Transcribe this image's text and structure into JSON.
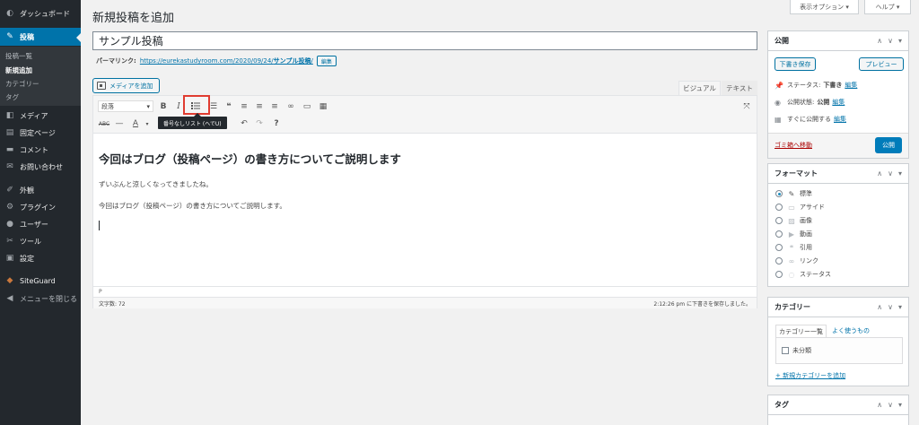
{
  "sidebar": {
    "items": [
      {
        "label": "ダッシュボード",
        "icon": "dashboard-icon",
        "glyph": "◐"
      },
      {
        "label": "投稿",
        "icon": "pin-icon",
        "glyph": "✎",
        "current": true
      },
      {
        "label": "メディア",
        "icon": "media-icon",
        "glyph": "◧"
      },
      {
        "label": "固定ページ",
        "icon": "page-icon",
        "glyph": "▤"
      },
      {
        "label": "コメント",
        "icon": "comment-icon",
        "glyph": "▬"
      },
      {
        "label": "お問い合わせ",
        "icon": "mail-icon",
        "glyph": "✉"
      },
      {
        "label": "外観",
        "icon": "brush-icon",
        "glyph": "✐"
      },
      {
        "label": "プラグイン",
        "icon": "plugin-icon",
        "glyph": "⚙"
      },
      {
        "label": "ユーザー",
        "icon": "user-icon",
        "glyph": "●"
      },
      {
        "label": "ツール",
        "icon": "wrench-icon",
        "glyph": "✂"
      },
      {
        "label": "設定",
        "icon": "settings-icon",
        "glyph": "▣"
      },
      {
        "label": "SiteGuard",
        "icon": "siteguard-icon",
        "glyph": "◆"
      },
      {
        "label": "メニューを閉じる",
        "icon": "collapse-icon",
        "glyph": "◀"
      }
    ],
    "submenu": [
      "投稿一覧",
      "新規追加",
      "カテゴリー",
      "タグ"
    ]
  },
  "header": {
    "title": "新規投稿を追加",
    "screen_options": "表示オプション ▾",
    "help": "ヘルプ ▾"
  },
  "post": {
    "title": "サンプル投稿",
    "permalink_label": "パーマリンク:",
    "permalink_url": "https://eurekastudyroom.com/2020/09/24/",
    "permalink_slug": "サンプル投稿",
    "permalink_tail": "/",
    "edit_label": "編集"
  },
  "editor": {
    "media_button": "メディアを追加",
    "tab_visual": "ビジュアル",
    "tab_text": "テキスト",
    "format_select": "段落",
    "tooltip": "番号なしリスト (へでU)",
    "heading": "今回はブログ（投稿ページ）の書き方についてご説明します",
    "paragraph1": "ずいぶんと涼しくなってきましたね。",
    "paragraph2": "今回はブログ（投稿ページ）の書き方についてご説明します。",
    "path": "P",
    "word_count": "文字数: 72",
    "save_status": "2:12:26 pm に下書きを保存しました。"
  },
  "publish_box": {
    "title": "公開",
    "save_draft": "下書き保存",
    "preview": "プレビュー",
    "status_label": "ステータス:",
    "status_value": "下書き",
    "visibility_label": "公開状態:",
    "visibility_value": "公開",
    "schedule_label": "すぐに公開する",
    "edit": "編集",
    "trash": "ゴミ箱へ移動",
    "publish": "公開"
  },
  "format_box": {
    "title": "フォーマット",
    "options": [
      "標準",
      "アサイド",
      "画像",
      "動画",
      "引用",
      "リンク",
      "ステータス"
    ]
  },
  "category_box": {
    "title": "カテゴリー",
    "tab_all": "カテゴリー一覧",
    "tab_popular": "よく使うもの",
    "items": [
      "未分類"
    ],
    "add_new": "+ 新規カテゴリーを追加"
  },
  "tag_box": {
    "title": "タグ"
  },
  "colors": {
    "admin_bg": "#23282d",
    "accent": "#0073aa",
    "highlight": "#e03c31"
  }
}
